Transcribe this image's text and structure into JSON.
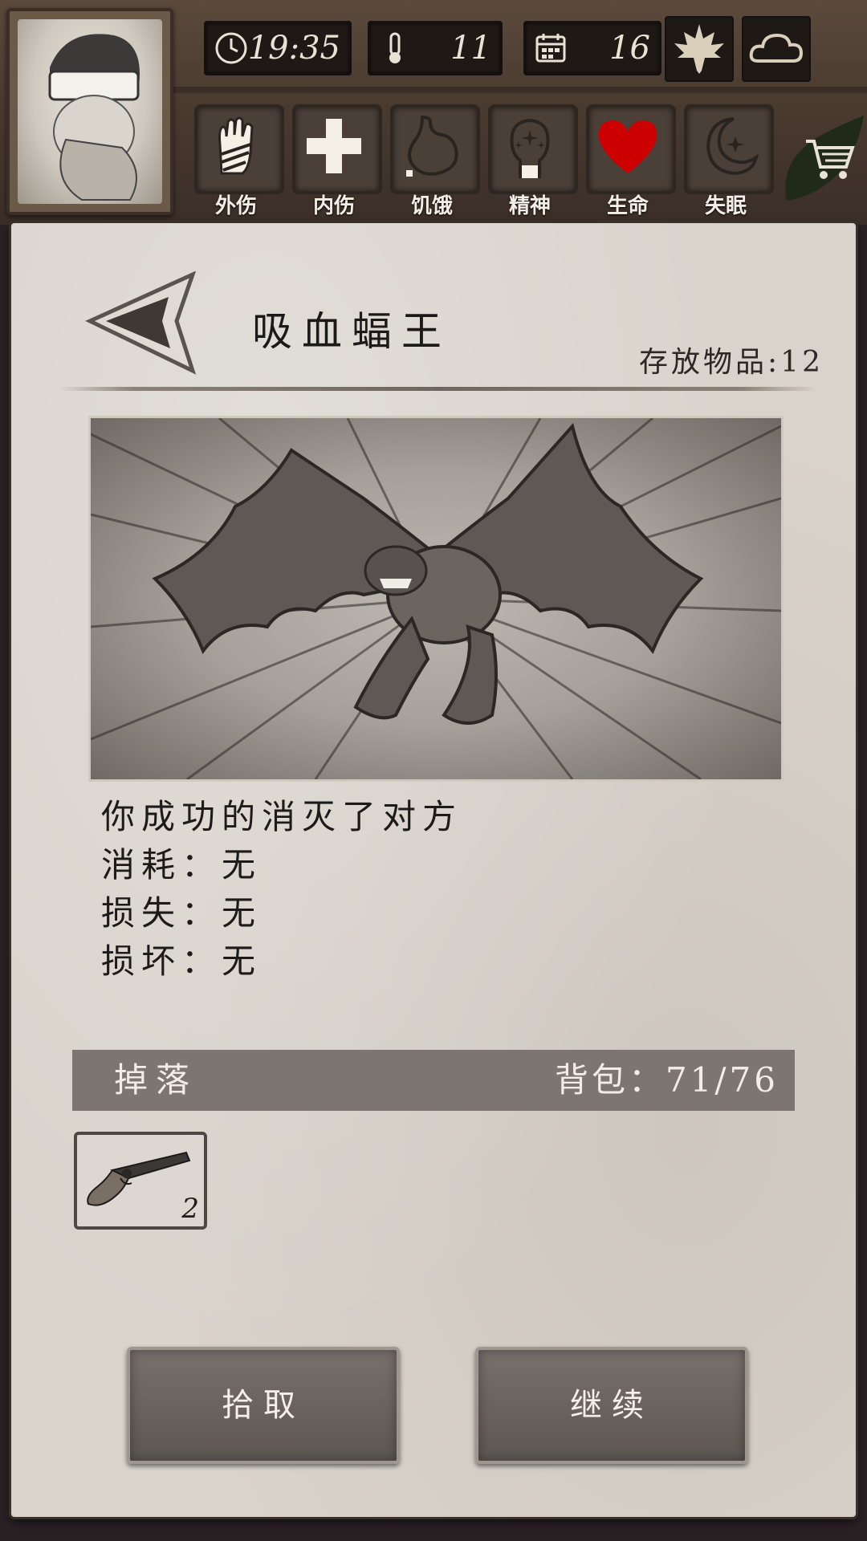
{
  "hud": {
    "time": "19:35",
    "temperature": "11",
    "day": "16",
    "stats": [
      {
        "label": "外伤",
        "icon": "bandaged-hand-icon"
      },
      {
        "label": "内伤",
        "icon": "cross-icon"
      },
      {
        "label": "饥饿",
        "icon": "stomach-icon"
      },
      {
        "label": "精神",
        "icon": "head-sparkle-icon"
      },
      {
        "label": "生命",
        "icon": "heart-icon"
      },
      {
        "label": "失眠",
        "icon": "moon-star-icon"
      }
    ]
  },
  "panel": {
    "title": "吸血蝠王",
    "storage": "存放物品:12"
  },
  "battle_result": {
    "line1": "你成功的消灭了对方",
    "consumed": "消耗：无",
    "lost": "损失：无",
    "damaged": "损坏：无"
  },
  "drops": {
    "label": "掉落",
    "backpack": "背包：71/76",
    "items": [
      {
        "icon": "flintlock-pistol-icon",
        "quantity": "2"
      }
    ]
  },
  "buttons": {
    "pickup": "拾取",
    "continue": "继续"
  },
  "colors": {
    "paper": "#d8d3cb",
    "heart": "#cc0000",
    "button": "#6a635e"
  }
}
